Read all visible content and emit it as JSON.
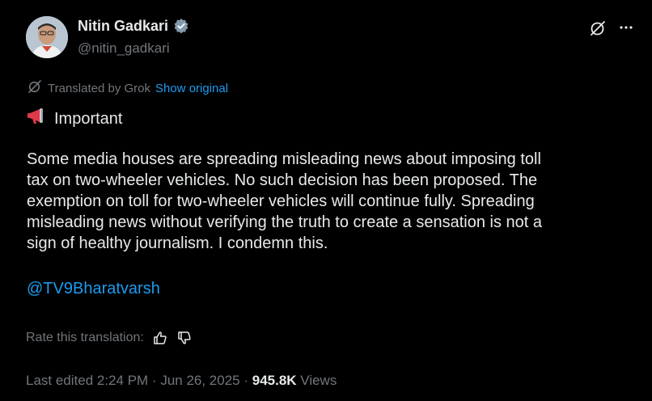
{
  "author": {
    "name": "Nitin Gadkari",
    "handle": "@nitin_gadkari",
    "verified_color": "#829aab"
  },
  "translation": {
    "label": "Translated by Grok",
    "show_original": "Show original"
  },
  "post": {
    "heading": "Important",
    "heading_icon": "megaphone-icon",
    "body": "Some media houses are spreading misleading news about imposing toll\ntax on two-wheeler vehicles. No such decision has been proposed. The\nexemption on toll for two-wheeler vehicles will continue fully. Spreading\nmisleading news without verifying the truth to create a sensation is not a\nsign of healthy journalism. I condemn this.",
    "mention": "@TV9Bharatvarsh"
  },
  "rating": {
    "label": "Rate this translation:"
  },
  "meta": {
    "edited": "Last edited 2:24 PM · Jun 26, 2025 · ",
    "views_count": "945.8K",
    "views_label": " Views"
  },
  "colors": {
    "background": "#000000",
    "text": "#e7e9ea",
    "muted": "#71767b",
    "link": "#1d9bf0"
  }
}
